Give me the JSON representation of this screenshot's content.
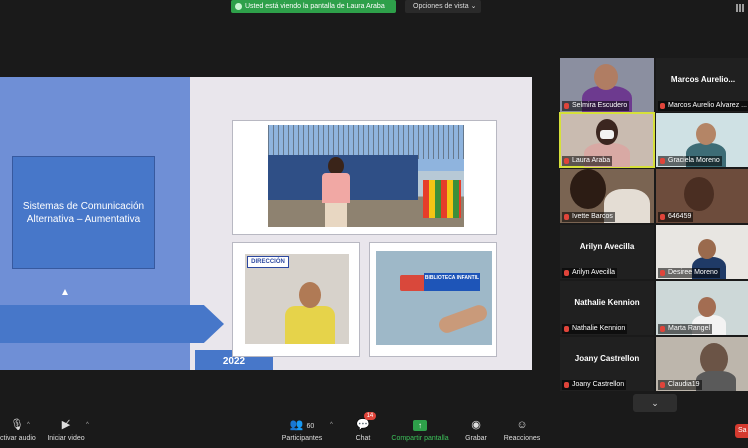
{
  "banner": {
    "viewing_text": "Usted está viendo la pantalla de Laura Araba",
    "view_options": "Opciones de vista"
  },
  "slide": {
    "title": "Sistemas de Comunicación Alternativa – Aumentativa",
    "year": "2022",
    "photo2_sign": "DIRECCIÓN",
    "photo3_sign": "BIBLIOTECA INFANTIL"
  },
  "participants": [
    {
      "name": "Selmira Escudero",
      "type": "video"
    },
    {
      "name": "Marcos Aurelio Alvarez ...",
      "big_label": "Marcos Aurelio...",
      "type": "name"
    },
    {
      "name": "Laura Araba",
      "type": "video",
      "active": true
    },
    {
      "name": "Graciela Moreno",
      "type": "video"
    },
    {
      "name": "Ivette Barcos",
      "type": "video"
    },
    {
      "name": "646459",
      "type": "video"
    },
    {
      "name": "Arilyn Avecilla",
      "big_label": "Arilyn Avecilla",
      "type": "name"
    },
    {
      "name": "Desiree Moreno",
      "type": "video"
    },
    {
      "name": "Nathalie Kennion",
      "big_label": "Nathalie Kennion",
      "type": "name"
    },
    {
      "name": "Marta Rangel",
      "type": "video"
    },
    {
      "name": "Joany Castrellon",
      "big_label": "Joany Castrellon",
      "type": "name"
    },
    {
      "name": "Claudia19",
      "type": "video"
    }
  ],
  "toolbar": {
    "audio_label": "ctivar audio",
    "video_label": "Iniciar video",
    "participants_label": "Participantes",
    "participants_count": "60",
    "chat_label": "Chat",
    "chat_badge": "14",
    "share_label": "Compartir pantalla",
    "record_label": "Grabar",
    "reactions_label": "Reacciones"
  },
  "colors": {
    "share_green": "#2ea04a",
    "slide_blue": "#4777c9",
    "active_speaker": "#d6e03a"
  }
}
